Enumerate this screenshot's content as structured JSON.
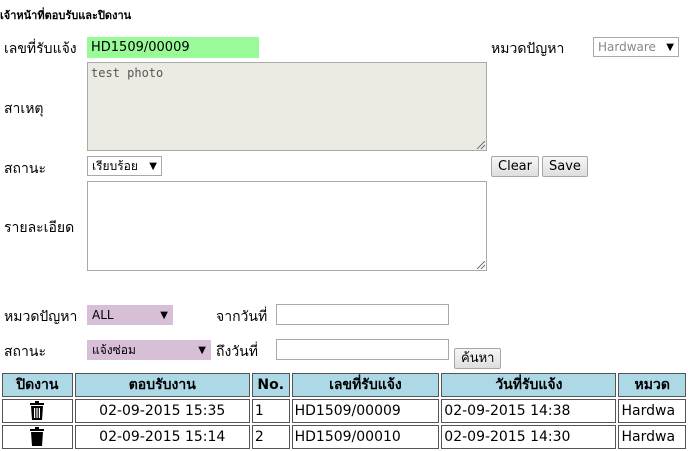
{
  "page": {
    "title": "เจ้าหน้าที่ตอบรับและปิดงาน"
  },
  "form": {
    "ticket_label": "เลขที่รับแจ้ง",
    "ticket_value": "HD1509/00009",
    "category_label": "หมวดปัญหา",
    "category_value": "Hardware",
    "cause_label": "สาเหตุ",
    "cause_value": "test photo",
    "status_label": "สถานะ",
    "status_value": "เรียบร้อย",
    "clear_label": "Clear",
    "save_label": "Save",
    "detail_label": "รายละเอียด",
    "detail_value": ""
  },
  "filter": {
    "category_label": "หมวดปัญหา",
    "category_value": "ALL",
    "from_label": "จากวันที่",
    "from_value": "",
    "status_label": "สถานะ",
    "status_value": "แจ้งซ่อม",
    "to_label": "ถึงวันที่",
    "to_value": "",
    "search_label": "ค้นหา"
  },
  "table": {
    "headers": [
      "ปิดงาน",
      "ตอบรับงาน",
      "No.",
      "เลขที่รับแจ้ง",
      "วันที่รับแจ้ง",
      "หมวด"
    ],
    "rows": [
      {
        "accepted": "02-09-2015 15:35",
        "no": "1",
        "ticket": "HD1509/00009",
        "date": "02-09-2015 14:38",
        "category": "Hardwa"
      },
      {
        "accepted": "02-09-2015 15:14",
        "no": "2",
        "ticket": "HD1509/00010",
        "date": "02-09-2015 14:30",
        "category": "Hardwa"
      }
    ]
  },
  "icons": {
    "close_job": "trash-icon",
    "dropdown": "chevron-down-icon"
  }
}
